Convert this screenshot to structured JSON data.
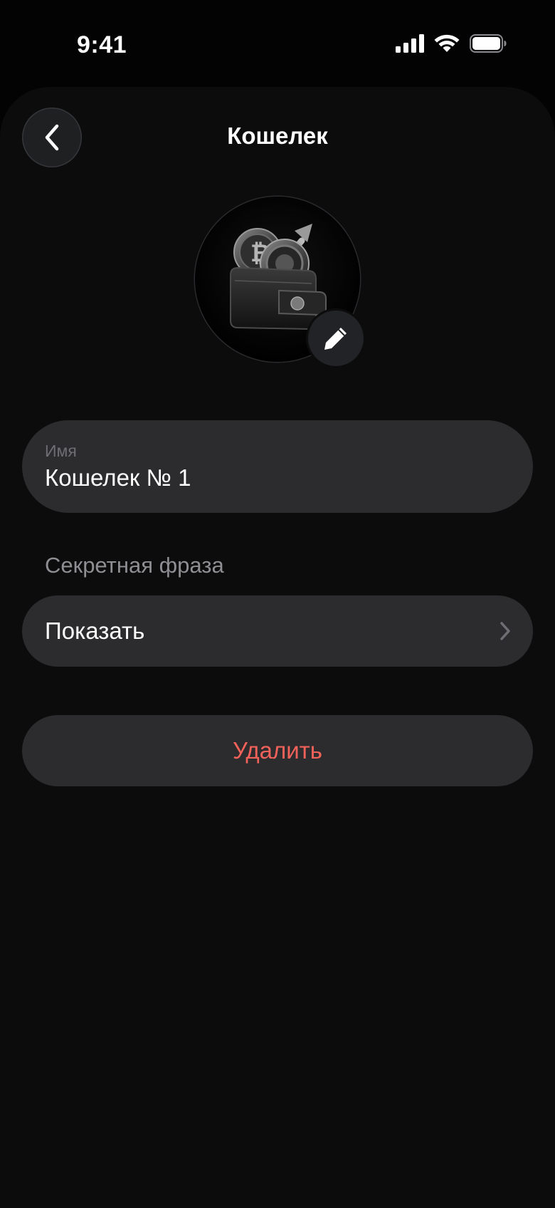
{
  "status_bar": {
    "time": "9:41",
    "signal_icon": "cellular-signal-icon",
    "wifi_icon": "wifi-icon",
    "battery_icon": "battery-icon"
  },
  "header": {
    "back_icon": "chevron-left-icon",
    "title": "Кошелек"
  },
  "avatar": {
    "image_icon": "wallet-crypto-icon",
    "edit_icon": "pencil-icon"
  },
  "name_field": {
    "label": "Имя",
    "value": "Кошелек № 1"
  },
  "secret_phrase": {
    "section_label": "Секретная фраза",
    "show_label": "Показать",
    "chevron_icon": "chevron-right-icon"
  },
  "delete": {
    "label": "Удалить"
  },
  "colors": {
    "background": "#0c0c0d",
    "card": "#2c2c2e",
    "danger": "#f2625a",
    "secondary_text": "#8e8e93"
  }
}
